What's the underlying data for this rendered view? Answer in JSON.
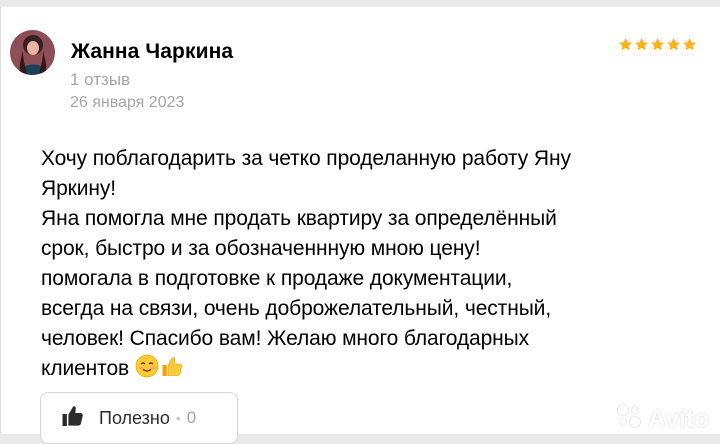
{
  "review": {
    "author_name": "Жанна Чаркина",
    "review_count": "1 отзыв",
    "date": "26 января 2023",
    "rating": 5,
    "text": "Хочу поблагодарить за четко проделанную работу Яну\nЯркину!\nЯна помогла мне продать квартиру за определённый\nсрок, быстро и за обозначеннную мною цену!\nпомогала в подготовке к продаже документации,\nвсегда на связи, очень доброжелательный, честный,\nчеловек! Спасибо вам! Желаю много благодарных\nклиентов"
  },
  "helpful": {
    "label": "Полезно",
    "separator": "•",
    "count": "0"
  },
  "watermark": {
    "text": "Avito"
  },
  "colors": {
    "star": "#ffb021",
    "muted_text": "#a5a5a5",
    "border": "#d6d6d6"
  }
}
